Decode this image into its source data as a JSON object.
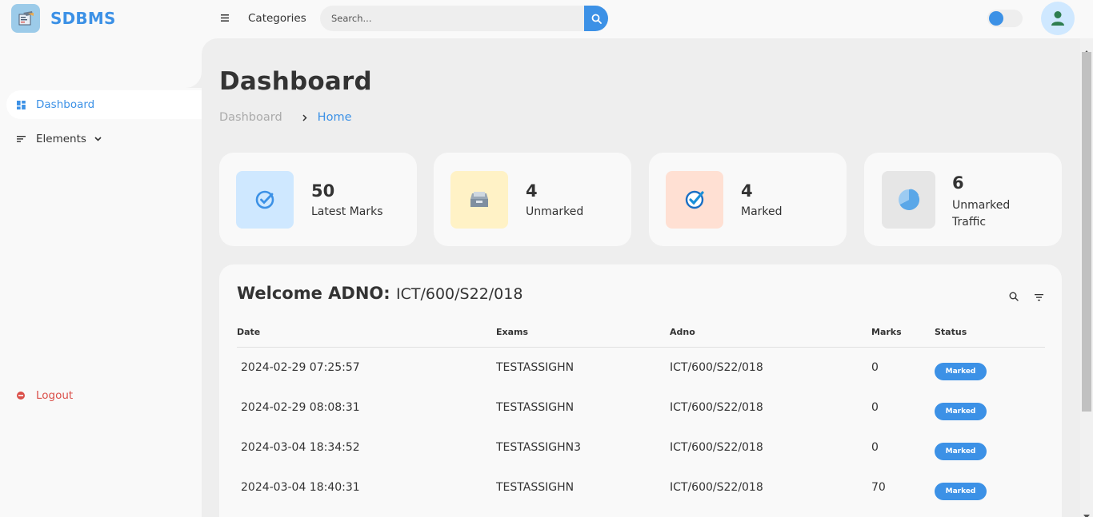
{
  "app": {
    "brand_name": "SDBMS",
    "icon": "school-board-logo"
  },
  "header": {
    "menu_icon": "hamburger-menu-icon",
    "categories_label": "Categories",
    "search": {
      "placeholder": "Search...",
      "value": "",
      "icon": "search-icon"
    },
    "theme_toggle": {
      "on": false
    },
    "profile_icon": "user-avatar-icon"
  },
  "sidebar": {
    "items": [
      {
        "label": "Dashboard",
        "icon": "dashboard-grid-icon",
        "active": true
      },
      {
        "label": "Elements",
        "icon": "list-lines-icon",
        "has_dropdown": true
      },
      {
        "label": "Logout",
        "icon": "logout-icon"
      }
    ]
  },
  "main": {
    "title": "Dashboard",
    "breadcrumb": [
      "Dashboard",
      "Home"
    ],
    "stats": [
      {
        "value": "50",
        "label": "Latest Marks",
        "icon": "check-circle-icon",
        "bg": "#cfe8ff",
        "color": "#3c91e6"
      },
      {
        "value": "4",
        "label": "Unmarked",
        "icon": "inbox-tray-icon",
        "bg": "#fff2c6",
        "color": "#7a8a99"
      },
      {
        "value": "4",
        "label": "Marked",
        "icon": "checked-badge-icon",
        "bg": "#ffe0d3",
        "color": "#1a8fd8"
      },
      {
        "value": "6",
        "label": "Unmarked Traffic",
        "icon": "pie-chart-icon",
        "bg": "#eee",
        "color": "#5aa7e8"
      }
    ],
    "table": {
      "welcome_prefix": "Welcome ADNO:",
      "welcome_adno": "ICT/600/S22/018",
      "columns": [
        "Date",
        "Exams",
        "Adno",
        "Marks",
        "Status"
      ],
      "rows": [
        {
          "date": "2024-02-29 07:25:57",
          "exam": "TESTASSIGHN",
          "adno": "ICT/600/S22/018",
          "marks": "0",
          "status": "Marked"
        },
        {
          "date": "2024-02-29 08:08:31",
          "exam": "TESTASSIGHN",
          "adno": "ICT/600/S22/018",
          "marks": "0",
          "status": "Marked"
        },
        {
          "date": "2024-03-04 18:34:52",
          "exam": "TESTASSIGHN3",
          "adno": "ICT/600/S22/018",
          "marks": "0",
          "status": "Marked"
        },
        {
          "date": "2024-03-04 18:40:31",
          "exam": "TESTASSIGHN",
          "adno": "ICT/600/S22/018",
          "marks": "70",
          "status": "Marked"
        }
      ]
    }
  },
  "colors": {
    "accent": "#3c91e6",
    "danger": "#db504a",
    "content_bg": "#eee",
    "surface": "#f9f9f9"
  }
}
